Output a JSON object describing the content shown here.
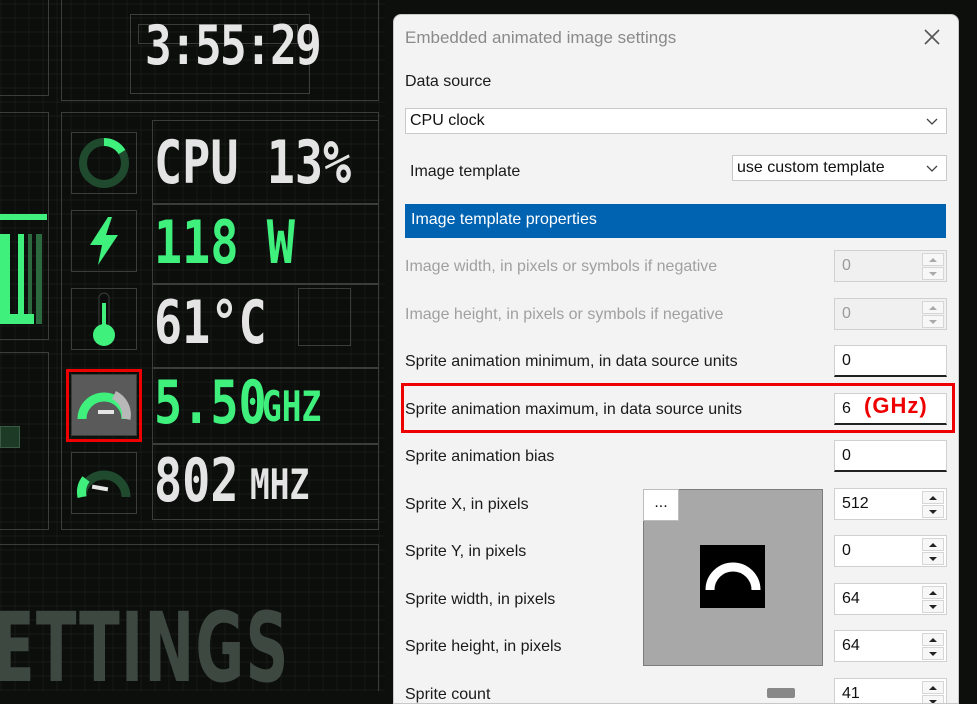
{
  "dashboard": {
    "clock": "3:55:29",
    "metrics": [
      {
        "value": "CPU 13%",
        "unit": "",
        "color": "#e4e4e4"
      },
      {
        "value": "118 W",
        "unit": "",
        "color": "#3ff07d"
      },
      {
        "value": "61°C",
        "unit": "",
        "color": "#e4e4e4"
      },
      {
        "value": "5.50",
        "unit": "GHZ",
        "color": "#3ff07d"
      },
      {
        "value": "802",
        "unit": "MHZ",
        "color": "#e4e4e4"
      }
    ],
    "icons": [
      "cpu-load-ring-icon",
      "power-bolt-icon",
      "thermometer-icon",
      "cpu-clock-gauge-icon",
      "memory-clock-gauge-icon"
    ],
    "background_word": "ETTINGS",
    "accent": "#3ff07d"
  },
  "dialog": {
    "title": "Embedded animated image settings",
    "data_source_label": "Data source",
    "data_source_value": "CPU clock",
    "template_label": "Image template",
    "template_value": "use custom template",
    "section_title": "Image template properties",
    "rows": [
      {
        "label": "Image width, in pixels or symbols if negative",
        "value": "0",
        "disabled": true
      },
      {
        "label": "Image height, in pixels or symbols if negative",
        "value": "0",
        "disabled": true
      },
      {
        "label": "Sprite animation minimum, in data source units",
        "value": "0"
      },
      {
        "label": "Sprite animation maximum, in data source units",
        "value": "6"
      },
      {
        "label": "Sprite animation bias",
        "value": "0"
      },
      {
        "label": "Sprite X, in pixels",
        "value": "512"
      },
      {
        "label": "Sprite Y, in pixels",
        "value": "0"
      },
      {
        "label": "Sprite width, in pixels",
        "value": "64"
      },
      {
        "label": "Sprite height, in pixels",
        "value": "64"
      },
      {
        "label": "Sprite count",
        "value": "41"
      }
    ],
    "annotation": "(GHz)",
    "browse_label": "...",
    "highlight_color": "#e00000",
    "section_color": "#0063b1"
  }
}
